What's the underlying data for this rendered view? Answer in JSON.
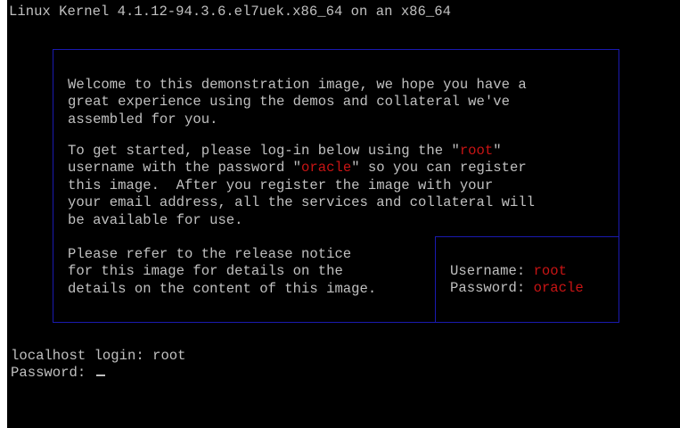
{
  "kernel_line": "Linux Kernel 4.1.12-94.3.6.el7uek.x86_64 on an x86_64",
  "welcome": {
    "line1": "Welcome to this demonstration image, we hope you have a",
    "line2": "great experience using the demos and collateral we've",
    "line3": "assembled for you."
  },
  "getting_started": {
    "l1_a": "To get started, please log-in below using the \"",
    "l1_root": "root",
    "l1_b": "\"",
    "l2_a": "username with the password \"",
    "l2_oracle": "oracle",
    "l2_b": "\" so you can register",
    "line3": "this image.  After you register the image with your",
    "line4": "your email address, all the services and collateral will",
    "line5": "be available for use."
  },
  "release": {
    "line1": "Please refer to the release notice",
    "line2": "for this image for details on the",
    "line3": "details on the content of this image."
  },
  "credentials": {
    "username_label": "Username: ",
    "username_value": "root",
    "password_label": "Password: ",
    "password_value": "oracle"
  },
  "login": {
    "prompt": "localhost login: ",
    "value": "root",
    "password_prompt": "Password: "
  },
  "colors": {
    "background": "#000000",
    "text": "#c0c0c0",
    "highlight": "#c81414",
    "frame": "#1a1ab0"
  }
}
